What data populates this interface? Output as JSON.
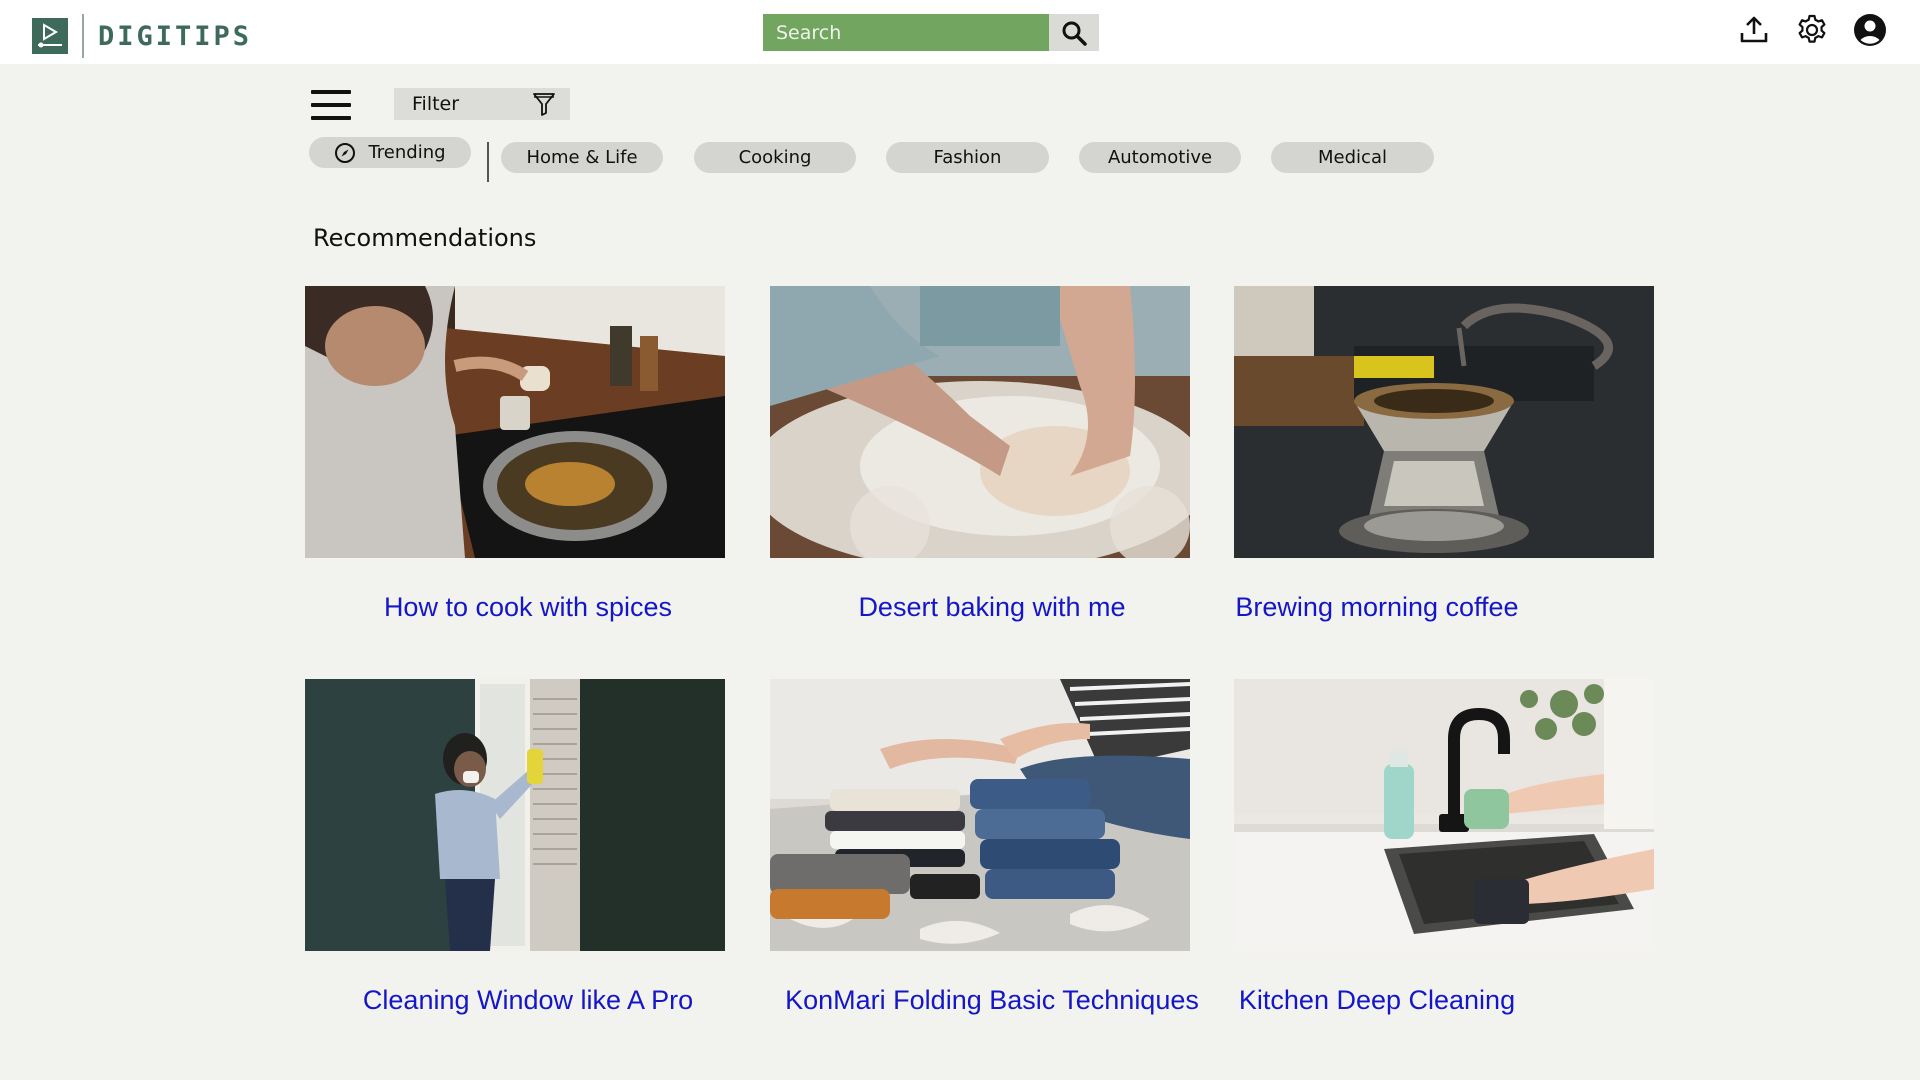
{
  "app": {
    "name": "DIGITIPS"
  },
  "search": {
    "placeholder": "Search"
  },
  "header_icons": [
    "upload-icon",
    "settings-icon",
    "account-icon"
  ],
  "filter": {
    "label": "Filter"
  },
  "categories": [
    {
      "label": "Trending",
      "icon": "compass-icon"
    },
    {
      "label": "Home & Life"
    },
    {
      "label": "Cooking"
    },
    {
      "label": "Fashion"
    },
    {
      "label": "Automotive"
    },
    {
      "label": "Medical"
    }
  ],
  "section": {
    "title": "Recommendations"
  },
  "videos": [
    {
      "title": "How to cook with spices"
    },
    {
      "title": "Desert baking with me"
    },
    {
      "title": "Brewing morning coffee"
    },
    {
      "title": "Cleaning Window like A Pro"
    },
    {
      "title": "KonMari Folding Basic Techniques"
    },
    {
      "title": "Kitchen Deep Cleaning"
    }
  ],
  "colors": {
    "brand": "#3e6a5c",
    "search": "#72a55f",
    "link": "#1416c8",
    "background": "#f2f3ef"
  }
}
